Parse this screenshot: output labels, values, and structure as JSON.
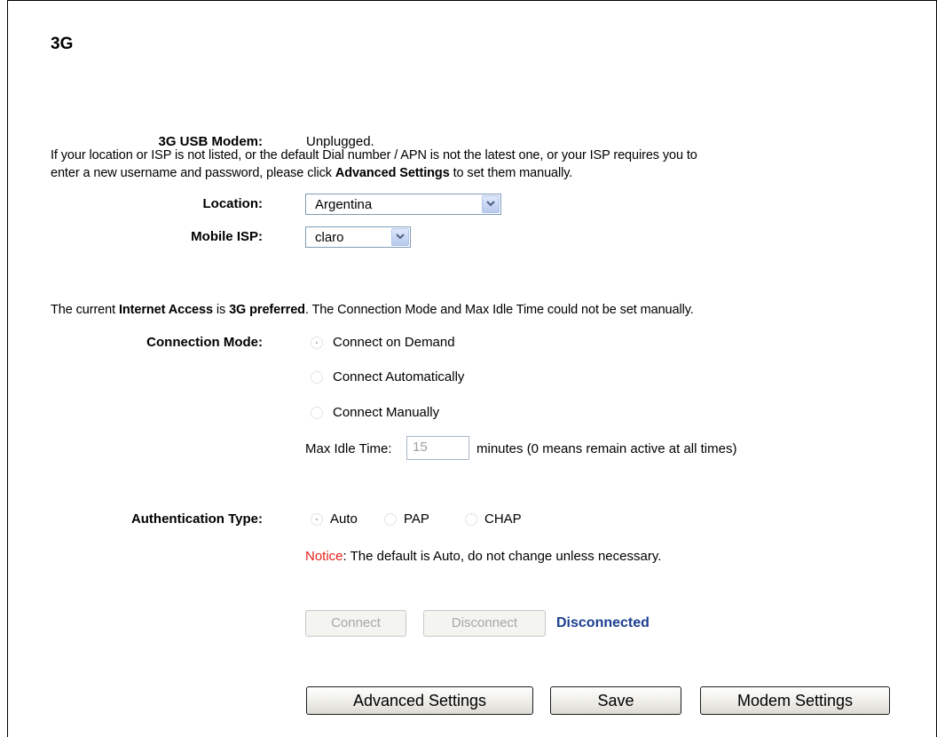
{
  "page": {
    "title": "3G"
  },
  "modem": {
    "label": "3G USB Modem:",
    "value": "Unplugged."
  },
  "info": {
    "line1": "If your location or ISP is not listed, or the default Dial number / APN is not the latest one, or your ISP requires you to",
    "line2_pre": "enter a new username and password, please click ",
    "line2_bold": "Advanced Settings",
    "line2_post": " to set them manually."
  },
  "location": {
    "label": "Location:",
    "value": "Argentina"
  },
  "isp": {
    "label": "Mobile ISP:",
    "value": "claro"
  },
  "access_note": {
    "pre": "The current ",
    "bold1": "Internet Access",
    "mid": " is ",
    "bold2": "3G preferred",
    "post": ". The Connection Mode and Max Idle Time could not be set manually."
  },
  "connection_mode": {
    "label": "Connection Mode:",
    "options": [
      "Connect on Demand",
      "Connect Automatically",
      "Connect Manually"
    ],
    "selected": 0
  },
  "idle": {
    "label": "Max Idle Time:",
    "value": "15",
    "suffix": "minutes (0 means remain active at all times)"
  },
  "auth": {
    "label": "Authentication Type:",
    "options": [
      "Auto",
      "PAP",
      "CHAP"
    ],
    "selected": 0
  },
  "notice": {
    "prefix": "Notice",
    "text": ": The default is Auto, do not change unless necessary."
  },
  "connect": {
    "connect_label": "Connect",
    "disconnect_label": "Disconnect",
    "status": "Disconnected"
  },
  "footer": {
    "advanced_label": "Advanced Settings",
    "save_label": "Save",
    "modem_label": "Modem Settings"
  },
  "colors": {
    "notice_red": "#e8221c",
    "status_blue": "#1b3f91"
  }
}
